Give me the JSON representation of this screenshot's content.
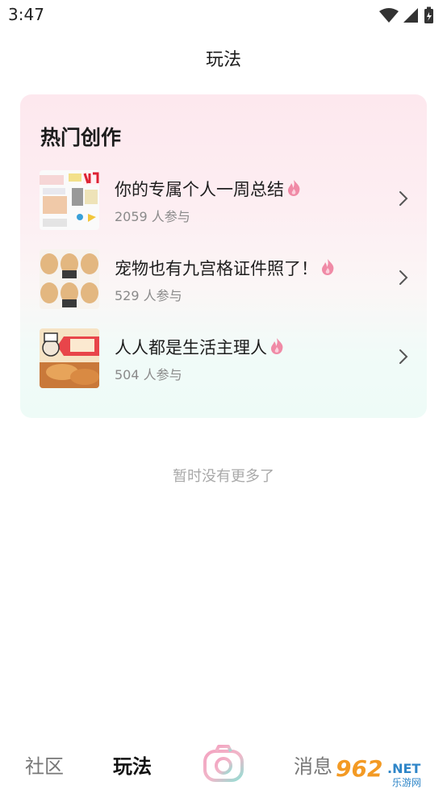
{
  "status_bar": {
    "time": "3:47",
    "icons": [
      "wifi-icon",
      "signal-icon",
      "battery-icon"
    ]
  },
  "page": {
    "title": "玩法"
  },
  "hot_section": {
    "title": "热门创作",
    "items": [
      {
        "title": "你的专属个人一周总结",
        "count": "2059 人参与",
        "icon": "flame-icon"
      },
      {
        "title": "宠物也有九宫格证件照了！",
        "count": "529 人参与",
        "icon": "flame-icon"
      },
      {
        "title": "人人都是生活主理人",
        "count": "504 人参与",
        "icon": "flame-icon"
      }
    ]
  },
  "footer_note": "暂时没有更多了",
  "tabbar": {
    "community": "社区",
    "play": "玩法",
    "camera": "camera-icon",
    "messages": "消息"
  },
  "watermark": {
    "text": "962.NET",
    "subtext": "乐游网"
  },
  "colors": {
    "flame": "#f08aa6",
    "accent_pink": "#f2a0be",
    "accent_teal": "#8ee0d6"
  }
}
